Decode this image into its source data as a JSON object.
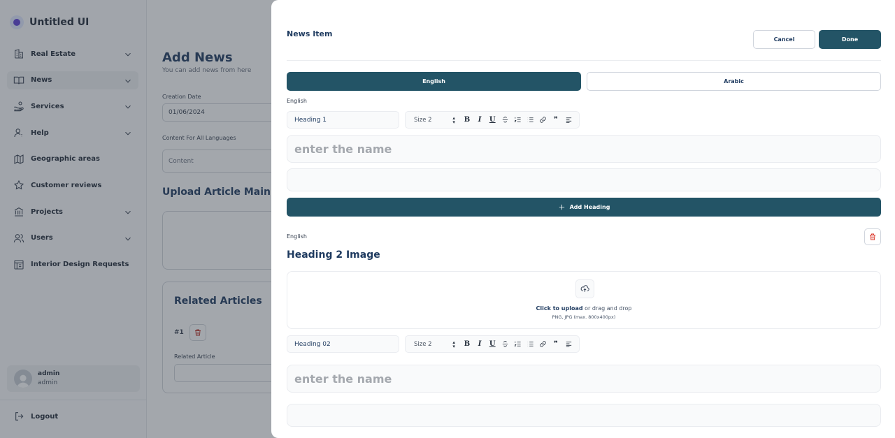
{
  "sidebar": {
    "brand": "Untitled UI",
    "items": [
      {
        "label": "Real Estate",
        "icon": "building-icon",
        "chevron": true
      },
      {
        "label": "News",
        "icon": "book-open-icon",
        "chevron": true,
        "active": true
      },
      {
        "label": "Services",
        "icon": "hand-coins-icon",
        "chevron": true
      },
      {
        "label": "Help",
        "icon": "user-help-icon",
        "chevron": true
      },
      {
        "label": "Geographic areas",
        "icon": "map-icon",
        "chevron": false
      },
      {
        "label": "Customer reviews",
        "icon": "star-icon",
        "chevron": false
      },
      {
        "label": "Projects",
        "icon": "bank-icon",
        "chevron": true
      },
      {
        "label": "Users",
        "icon": "users-icon",
        "chevron": true
      },
      {
        "label": "Interior Design Requests",
        "icon": "dashboard-icon",
        "chevron": false
      }
    ],
    "user": {
      "name": "admin",
      "role": "admin"
    },
    "logout": "Logout"
  },
  "page": {
    "title": "Add News",
    "subtitle": "You can add news from here",
    "creation_date_label": "Creation Date",
    "creation_date_value": "01/06/2024",
    "content_label": "Content For All Languages",
    "content_placeholder": "Content",
    "upload_title": "Upload Article Main In",
    "related_title": "Related Articles",
    "related_index": "#1",
    "related_article_label": "Related Article"
  },
  "drawer": {
    "title": "News Item",
    "cancel_label": "Cancel",
    "done_label": "Done",
    "tabs": [
      {
        "label": "English",
        "active": true
      },
      {
        "label": "Arabic",
        "active": false
      }
    ],
    "block1": {
      "language": "English",
      "heading_select": "Heading 1",
      "size_select": "Size 2",
      "name_placeholder": "enter the name"
    },
    "add_heading_label": "Add Heading",
    "block2": {
      "language": "English",
      "title": "Heading 2 Image",
      "upload_link": "Click to upload",
      "upload_text": "or drag and drop",
      "upload_hint": "PNG, JPG (max. 800x400px)",
      "heading_select": "Heading 02",
      "size_select": "Size 2",
      "name_placeholder": "enter the name"
    }
  },
  "colors": {
    "primary": "#235466",
    "heading": "#1e3a5f",
    "danger": "#d92d20",
    "overlay": "rgba(52, 60, 72, 0.45)"
  }
}
